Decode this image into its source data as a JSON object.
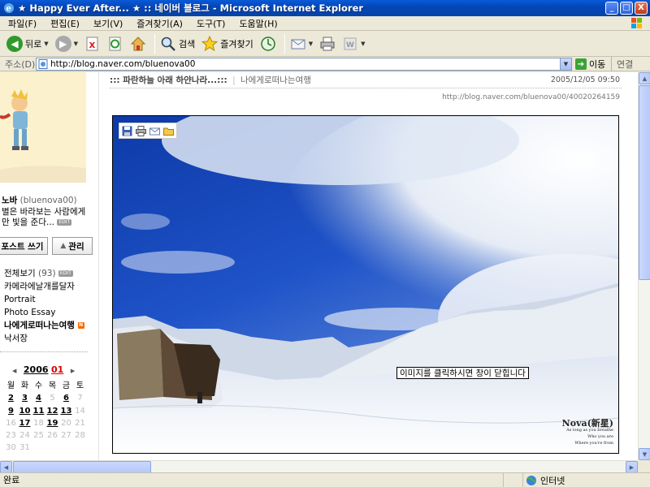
{
  "window": {
    "title": "★ Happy Ever After... ★ :: 네이버 블로그 - Microsoft Internet Explorer",
    "minimize": "_",
    "maximize": "□",
    "close": "X"
  },
  "menu": [
    "파일(F)",
    "편집(E)",
    "보기(V)",
    "즐겨찾기(A)",
    "도구(T)",
    "도움말(H)"
  ],
  "toolbar": {
    "back_label": "뒤로",
    "search_label": "검색",
    "favorites_label": "즐겨찾기"
  },
  "address": {
    "label": "주소(D)",
    "url": "http://blog.naver.com/bluenova00",
    "go_label": "이동",
    "links_label": "연결"
  },
  "sidebar": {
    "nickname": "노바",
    "user_id": "(bluenova00)",
    "description": "별은 바라보는 사람에게만 빛을 준다...",
    "edit_badge": "EDIT",
    "write_button": "포스트 쓰기",
    "manage_button": "관리",
    "categories": [
      {
        "label": "전체보기",
        "count": "(93)",
        "badge": "EDIT"
      },
      {
        "label": "카메라에날개를달자",
        "count": "",
        "badge": ""
      },
      {
        "label": "Portrait",
        "count": "",
        "badge": ""
      },
      {
        "label": "Photo Essay",
        "count": "",
        "badge": ""
      },
      {
        "label": "나에게로떠나는여행",
        "count": "",
        "badge": "N"
      },
      {
        "label": "낙서장",
        "count": "",
        "badge": ""
      }
    ],
    "calendar": {
      "year": "2006",
      "month": "01",
      "prev": "◀",
      "next": "▶",
      "weekdays": [
        "월",
        "화",
        "수",
        "목",
        "금",
        "토"
      ],
      "weeks": [
        [
          {
            "d": "2",
            "on": true
          },
          {
            "d": "3",
            "on": true
          },
          {
            "d": "4",
            "on": true
          },
          {
            "d": "5",
            "on": false
          },
          {
            "d": "6",
            "on": true
          },
          {
            "d": "7",
            "on": false
          }
        ],
        [
          {
            "d": "9",
            "on": true
          },
          {
            "d": "10",
            "on": true
          },
          {
            "d": "11",
            "on": true
          },
          {
            "d": "12",
            "on": true
          },
          {
            "d": "13",
            "on": true
          },
          {
            "d": "14",
            "on": false
          }
        ],
        [
          {
            "d": "16",
            "on": false
          },
          {
            "d": "17",
            "on": true
          },
          {
            "d": "18",
            "on": false
          },
          {
            "d": "19",
            "on": true
          },
          {
            "d": "20",
            "on": false
          },
          {
            "d": "21",
            "on": false
          }
        ],
        [
          {
            "d": "23",
            "on": false
          },
          {
            "d": "24",
            "on": false
          },
          {
            "d": "25",
            "on": false
          },
          {
            "d": "26",
            "on": false
          },
          {
            "d": "27",
            "on": false
          },
          {
            "d": "28",
            "on": false
          }
        ],
        [
          {
            "d": "30",
            "on": false
          },
          {
            "d": "31",
            "on": false
          },
          {
            "d": "",
            "on": false
          },
          {
            "d": "",
            "on": false
          },
          {
            "d": "",
            "on": false
          },
          {
            "d": "",
            "on": false
          }
        ]
      ]
    }
  },
  "post": {
    "title": "::: 파란하늘 아래 하얀나라...:::",
    "separator": "|",
    "category": "나에게로떠나는여행",
    "date": "2005/12/05 09:50",
    "permalink": "http://blog.naver.com/bluenova00/40020264159",
    "photo_tooltip": "이미지를 클릭하시면 창이 닫힙니다",
    "signature_main": "Nova(新星)",
    "signature_line1": "As long as you breathe",
    "signature_line2": "Who you are",
    "signature_line3": "Where you're from"
  },
  "status": {
    "text": "완료",
    "zone": "인터넷"
  },
  "colors": {
    "titlebar": "#0a5ad9",
    "accent_red": "#dd0000",
    "sky": "#1a44b8"
  }
}
